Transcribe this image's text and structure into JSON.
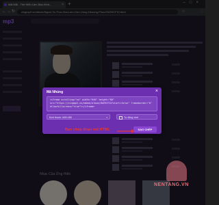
{
  "browser": {
    "tab_title": "Mãi Mãi - Thế Hiển Lâm Báu Kinh...",
    "url": "zingmp3.vn/album/Nguoi-Ta-Thuc-Mai-Lam-Oan-Uong-Nhuong-Phuc/ZWZ9CFIO.html",
    "close_glyph": "×",
    "newtab_glyph": "+",
    "window_controls": "–□×",
    "back_glyph": "←",
    "forward_glyph": "→",
    "reload_glyph": "↻",
    "star_glyph": "☆",
    "menu_glyph": "⋮"
  },
  "brand": {
    "logo_text": "mp3",
    "accent_color": "#a16aff"
  },
  "sections": {
    "recommend_title": "Nhạc Của Ứng Hiển"
  },
  "modal": {
    "title": "Mã Nhúng",
    "close_glyph": "×",
    "embed_code_lines": [
      "<iframe scrolling=\"no\" width=\"640\" height=\"80\"",
      "src=\"https://zingmp3.vn/embed/album/ZWZ9CFIO?start=false\" frameborder=\"0\"",
      "allowfullscreen=\"true\"></iframe>"
    ],
    "size_select_value": "Kích thước: 640×180",
    "size_arrow_glyph": "▾",
    "autoplay_label": "Tự động chơi",
    "copy_button_label": "SAO CHÉP"
  },
  "annotation": {
    "text": "Bao chép đoạn mã HTML",
    "color": "#e53935"
  },
  "watermark": {
    "text": "NENTANG.VN"
  }
}
